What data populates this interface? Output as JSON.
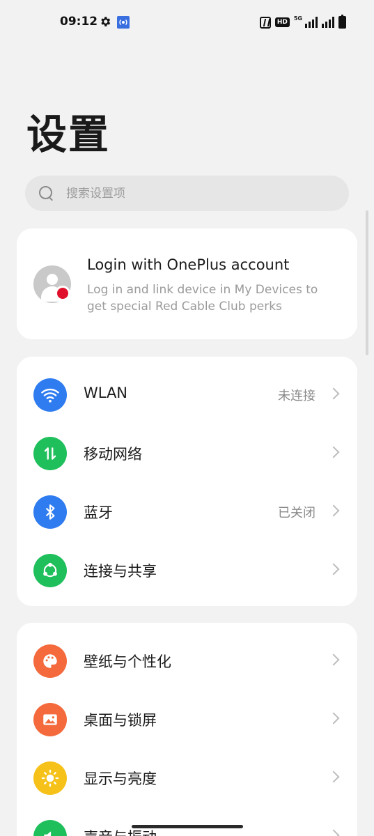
{
  "status_bar": {
    "time": "09:12",
    "hd_badge": "HD",
    "network_type": "5G",
    "icons": [
      "gear-icon",
      "hotspot-icon",
      "nfc-icon",
      "hd-icon",
      "signal-icon",
      "battery-icon"
    ]
  },
  "page": {
    "title": "设置"
  },
  "search": {
    "placeholder": "搜索设置项"
  },
  "account": {
    "title": "Login with OnePlus account",
    "subtitle": "Log in and link device in My Devices to get special Red Cable Club perks"
  },
  "group1": [
    {
      "label": "WLAN",
      "value": "未连接",
      "icon": "wifi-icon",
      "color": "#2f7cf0"
    },
    {
      "label": "移动网络",
      "value": "",
      "icon": "mobile-data-icon",
      "color": "#1fbf5c"
    },
    {
      "label": "蓝牙",
      "value": "已关闭",
      "icon": "bluetooth-icon",
      "color": "#2f7cf0"
    },
    {
      "label": "连接与共享",
      "value": "",
      "icon": "share-icon",
      "color": "#1fbf5c"
    }
  ],
  "group2": [
    {
      "label": "壁纸与个性化",
      "icon": "palette-icon",
      "color": "#f46a3c"
    },
    {
      "label": "桌面与锁屏",
      "icon": "image-icon",
      "color": "#f46a3c"
    },
    {
      "label": "显示与亮度",
      "icon": "sun-icon",
      "color": "#f6c21a"
    },
    {
      "label": "声音与振动",
      "icon": "speaker-icon",
      "color": "#1fbf5c"
    }
  ]
}
